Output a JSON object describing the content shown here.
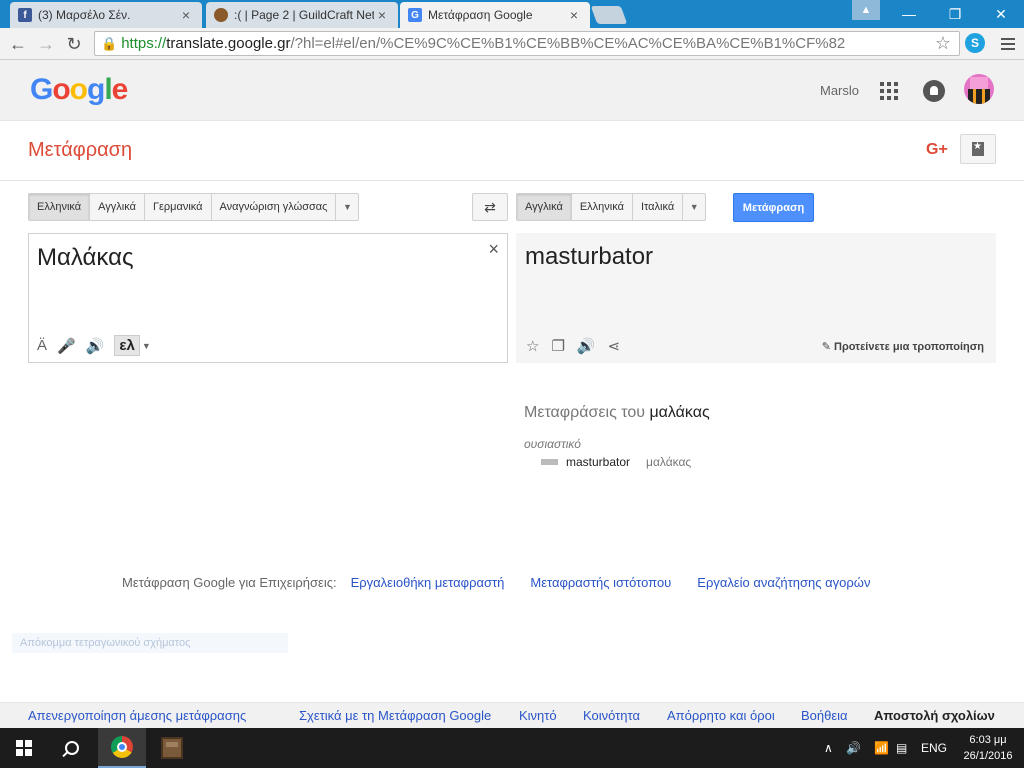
{
  "tabs": [
    {
      "title": "(3) Μαρσέλο Σέν.",
      "favicon": "facebook-icon",
      "color": "#3b5998",
      "close": "×"
    },
    {
      "title": ":( | Page 2 | GuildCraft Net",
      "favicon": "guildcraft-icon",
      "color": "#8b5a2b",
      "close": "×"
    },
    {
      "title": "Μετάφραση Google",
      "favicon": "google-translate-icon",
      "color": "#4285f4",
      "close": "×"
    }
  ],
  "window": {
    "minimize": "—",
    "maximize": "❐",
    "close": "✕"
  },
  "address": {
    "scheme": "https://",
    "host": "translate.google.gr",
    "rest": "/?hl=el#el/en/%CE%9C%CE%B1%CE%BB%CE%AC%CE%BA%CE%B1%CF%82"
  },
  "header": {
    "logo": [
      "G",
      "o",
      "o",
      "g",
      "l",
      "e"
    ],
    "username": "Marslo"
  },
  "app": {
    "title": "Μετάφραση",
    "gplus": "G+"
  },
  "source_langs": {
    "items": [
      "Ελληνικά",
      "Αγγλικά",
      "Γερμανικά",
      "Αναγνώριση γλώσσας"
    ],
    "selected": "Ελληνικά"
  },
  "target_langs": {
    "items": [
      "Αγγλικά",
      "Ελληνικά",
      "Ιταλικά"
    ],
    "selected": "Αγγλικά"
  },
  "swap_label": "⇄",
  "translate_button": "Μετάφραση",
  "source": {
    "text": "Μαλάκας",
    "clear": "×",
    "ime": "ελ",
    "accent": "Ä"
  },
  "target": {
    "text": "masturbator",
    "suggest": "Προτείνετε μια τροποποίηση"
  },
  "dictionary": {
    "title_prefix": "Μεταφράσεις του",
    "word": "μαλάκας",
    "pos": "ουσιαστικό",
    "entries": [
      {
        "word": "masturbator",
        "reverse": "μαλάκας",
        "frequency": 0.5
      }
    ]
  },
  "business": {
    "label": "Μετάφραση Google για Επιχειρήσεις:",
    "links": [
      "Εργαλειοθήκη μεταφραστή",
      "Μεταφραστής ιστότοπου",
      "Εργαλείο αναζήτησης αγορών"
    ]
  },
  "ghost_text": "Απόκομμα τετραγωνικού σχήματος",
  "footer": {
    "links": [
      "Απενεργοποίηση άμεσης μετάφρασης",
      "Σχετικά με τη Μετάφραση Google",
      "Κινητό",
      "Κοινότητα",
      "Απόρρητο και όροι",
      "Βοήθεια"
    ],
    "feedback": "Αποστολή σχολίων"
  },
  "taskbar": {
    "lang": "ENG",
    "time": "6:03 μμ",
    "date": "26/1/2016"
  },
  "colors": {
    "accent_blue": "#4d90fe",
    "title_red": "#dd4b39",
    "link": "#2a55c8"
  }
}
